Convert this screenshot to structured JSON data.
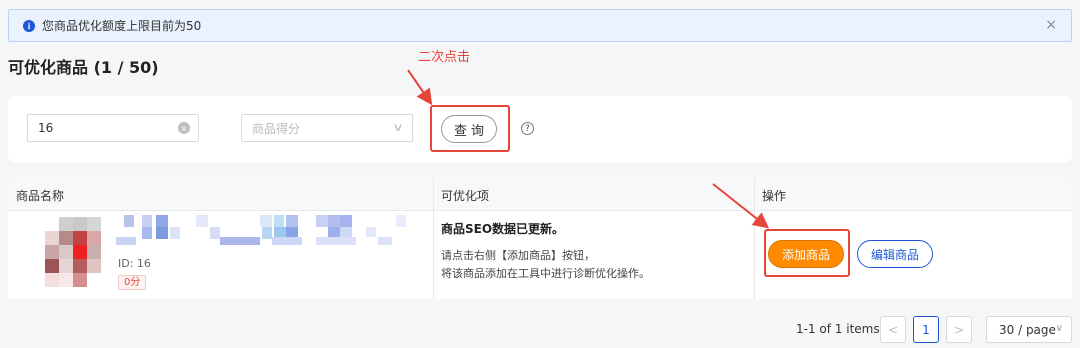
{
  "alert": {
    "text": "您商品优化额度上限目前为50",
    "close": "×"
  },
  "page_title": "可优化商品 (1 / 50)",
  "annotation": {
    "text": "二次点击"
  },
  "filters": {
    "search_value": "16",
    "clear_icon": "×",
    "select_placeholder": "商品得分",
    "select_chevron": "∨",
    "query_label": "查询",
    "help_icon": "?"
  },
  "table": {
    "headers": [
      "商品名称",
      "可优化项",
      "操作"
    ],
    "rows": [
      {
        "id_text": "ID: 16",
        "score": "0分",
        "opt_title": "商品SEO数据已更新。",
        "opt_desc1": "请点击右侧【添加商品】按钮，",
        "opt_desc2": "将该商品添加在工具中进行诊断优化操作。",
        "add_label": "添加商品",
        "edit_label": "编辑商品"
      }
    ]
  },
  "pagination": {
    "total": "1-1 of 1 items",
    "prev": "<",
    "current": "1",
    "next": ">",
    "page_size": "30 / page",
    "size_chevron": "∨"
  },
  "colors": {
    "accent": "#1d57d8",
    "orange": "#ff8a00",
    "annotation_red": "#e5453a"
  }
}
